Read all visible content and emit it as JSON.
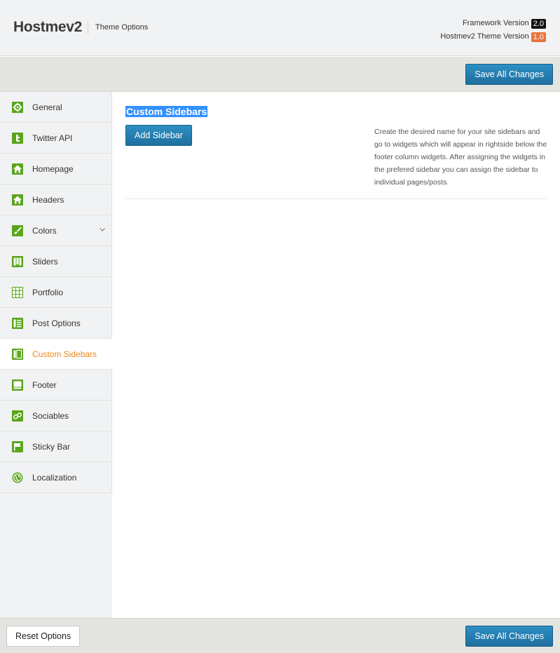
{
  "header": {
    "brand": "Hostmev2",
    "subtitle": "Theme Options",
    "framework_label": "Framework Version",
    "framework_version": "2.0",
    "theme_label": "Hostmev2 Theme Version",
    "theme_version": "1.0"
  },
  "toolbar": {
    "save_label": "Save All Changes"
  },
  "sidebar": {
    "items": [
      {
        "label": "General",
        "icon": "gear-icon"
      },
      {
        "label": "Twitter API",
        "icon": "twitter-icon"
      },
      {
        "label": "Homepage",
        "icon": "home-icon"
      },
      {
        "label": "Headers",
        "icon": "home-icon"
      },
      {
        "label": "Colors",
        "icon": "paintbrush-icon"
      },
      {
        "label": "Sliders",
        "icon": "slider-icon"
      },
      {
        "label": "Portfolio",
        "icon": "grid-icon"
      },
      {
        "label": "Post Options",
        "icon": "post-icon"
      },
      {
        "label": "Custom Sidebars",
        "icon": "sidebar-icon"
      },
      {
        "label": "Footer",
        "icon": "footer-icon"
      },
      {
        "label": "Sociables",
        "icon": "link-icon"
      },
      {
        "label": "Sticky Bar",
        "icon": "flag-icon"
      },
      {
        "label": "Localization",
        "icon": "globe-icon"
      }
    ],
    "active": "Custom Sidebars"
  },
  "main": {
    "title": "Custom Sidebars",
    "add_button": "Add Sidebar",
    "description": "Create the desired name for your site sidebars and go to widgets which will appear in rightside below the footer column widgets. After assigning the widgets in the prefered sidebar you can assign the sidebar to individual pages/posts."
  },
  "footer": {
    "reset_label": "Reset Options",
    "save_label": "Save All Changes"
  },
  "colors": {
    "accent_blue": "#2482b8",
    "active_orange": "#e8891c",
    "icon_green": "#5aa51d"
  }
}
